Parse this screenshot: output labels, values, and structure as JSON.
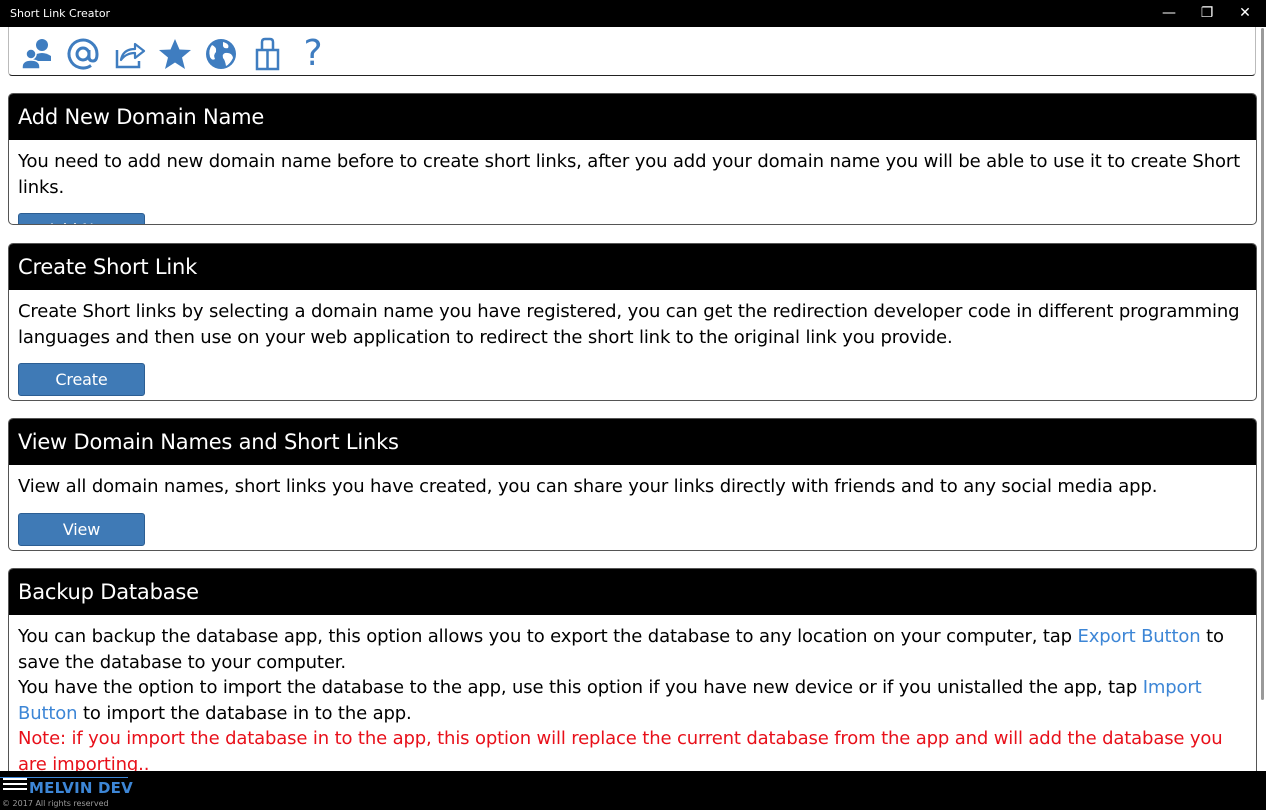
{
  "window": {
    "title": "Short Link Creator",
    "minimize_glyph": "—",
    "restore_glyph": "❐",
    "close_glyph": "✕"
  },
  "toolbar": {
    "icons": [
      "contacts-icon",
      "email-at-icon",
      "share-icon",
      "star-icon",
      "globe-icon",
      "gift-icon",
      "help-icon"
    ],
    "help_glyph": "?"
  },
  "sections": {
    "add_domain": {
      "title": "Add New Domain Name",
      "description": "You need to add new domain name before to create short links, after you add your domain name you will be able to use it to create Short links.",
      "button_label": "Add New"
    },
    "create_link": {
      "title": "Create Short Link",
      "description": "Create Short links by selecting a domain name you have registered, you can get the redirection developer code in different programming languages and then use on your web application to redirect the short link to the original link you provide.",
      "button_label": "Create"
    },
    "view": {
      "title": "View Domain Names and Short Links",
      "description": "View all domain names, short links you have created, you can share your links directly with friends and to any social media app.",
      "button_label": "View"
    },
    "backup": {
      "title": "Backup Database",
      "p1_before": "You can backup the database app, this option allows you to export the database to any location on your computer, tap ",
      "p1_link": "Export Button",
      "p1_after": " to save the database to your computer.",
      "p2_before": "You have the option to import the database to the app, use this option if you have new device or if you unistalled the app, tap ",
      "p2_link": "Import Button",
      "p2_after": " to import the database in to the app.",
      "note": "Note: if you import the database in to the app, this option will replace the current database from the app and will add the database you are importing.."
    }
  },
  "footer": {
    "brand": "MELVIN DEV",
    "copyright": "© 2017 All rights reserved"
  },
  "colors": {
    "accent": "#3f7ab6",
    "link": "#3d86d6",
    "note": "#e8101a",
    "header_bg": "#000000"
  }
}
